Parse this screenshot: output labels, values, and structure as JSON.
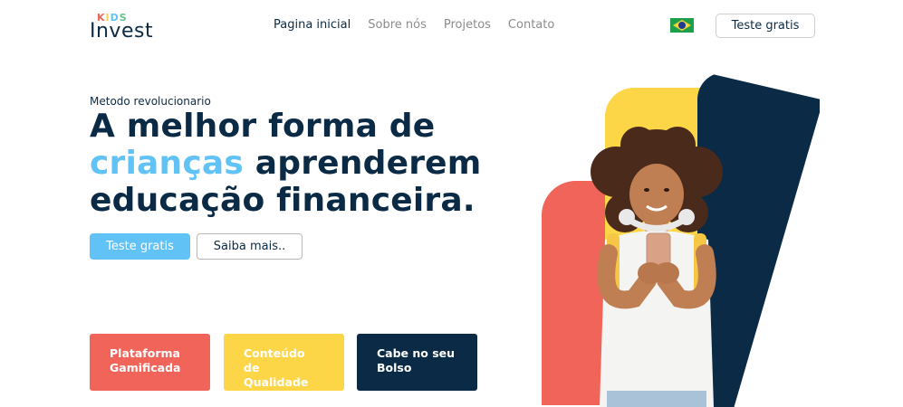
{
  "brand": {
    "kids": [
      "K",
      "I",
      "D",
      "S"
    ],
    "name": "Invest"
  },
  "nav": {
    "items": [
      {
        "label": "Pagina inicial",
        "active": true
      },
      {
        "label": "Sobre nós",
        "active": false
      },
      {
        "label": "Projetos",
        "active": false
      },
      {
        "label": "Contato",
        "active": false
      }
    ]
  },
  "header": {
    "language_icon": "brazil-flag-icon",
    "cta_label": "Teste gratis"
  },
  "hero": {
    "eyebrow": "Metodo revolucionario",
    "headline_part1": "A melhor forma de",
    "headline_highlight": "crianças",
    "headline_part2": "aprenderem",
    "headline_part3": "educação financeira.",
    "primary_button": "Teste gratis",
    "secondary_button": "Saiba mais.."
  },
  "features": [
    {
      "line1": "Plataforma",
      "line2": "Gamificada"
    },
    {
      "line1": "Conteúdo de",
      "line2": "Qualidade"
    },
    {
      "line1": "Cabe no seu",
      "line2": "Bolso"
    }
  ],
  "colors": {
    "navy": "#0b2a45",
    "sky": "#61c3f5",
    "coral": "#f0645a",
    "yellow": "#fdd648"
  }
}
